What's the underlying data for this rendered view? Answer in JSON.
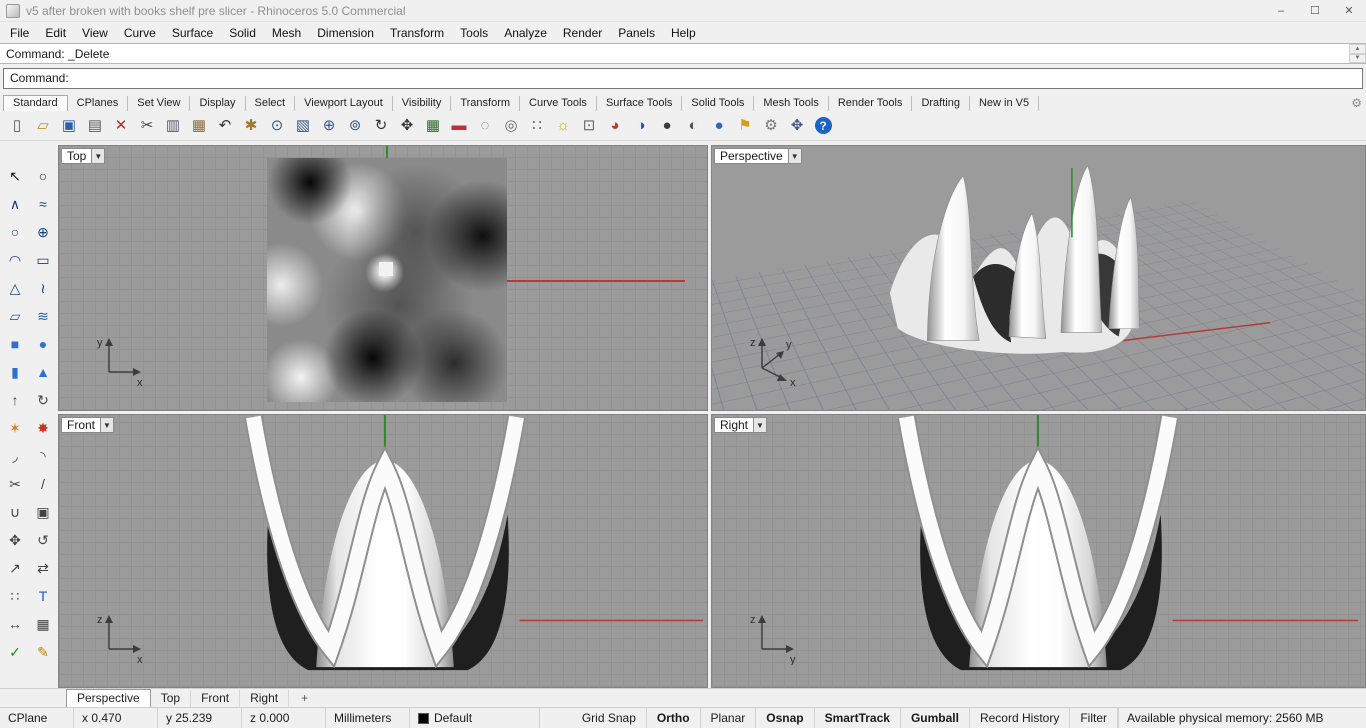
{
  "window": {
    "title": "v5 after broken with books shelf pre slicer - Rhinoceros 5.0 Commercial",
    "controls": {
      "minimize": "–",
      "maximize": "☐",
      "close": "✕"
    }
  },
  "menubar": {
    "items": [
      "File",
      "Edit",
      "View",
      "Curve",
      "Surface",
      "Solid",
      "Mesh",
      "Dimension",
      "Transform",
      "Tools",
      "Analyze",
      "Render",
      "Panels",
      "Help"
    ]
  },
  "command": {
    "history": "Command: _Delete",
    "prompt": "Command:",
    "scroll_up": "▲",
    "scroll_down": "▼"
  },
  "toolbar_tabs": {
    "active": "Standard",
    "gear": "⚙",
    "items": [
      "Standard",
      "CPlanes",
      "Set View",
      "Display",
      "Select",
      "Viewport Layout",
      "Visibility",
      "Transform",
      "Curve Tools",
      "Surface Tools",
      "Solid Tools",
      "Mesh Tools",
      "Render Tools",
      "Drafting",
      "New in V5"
    ]
  },
  "toolbar_icons": [
    {
      "name": "new-file-icon",
      "glyph": "▯",
      "color": "#555555"
    },
    {
      "name": "open-file-icon",
      "glyph": "▱",
      "color": "#b8912a"
    },
    {
      "name": "save-icon",
      "glyph": "▣",
      "color": "#2b5fae"
    },
    {
      "name": "print-icon",
      "glyph": "▤",
      "color": "#555555"
    },
    {
      "name": "delete-icon",
      "glyph": "✕",
      "color": "#b03030"
    },
    {
      "name": "cut-icon",
      "glyph": "✂",
      "color": "#444444"
    },
    {
      "name": "copy-icon",
      "glyph": "▥",
      "color": "#555566"
    },
    {
      "name": "paste-icon",
      "glyph": "▦",
      "color": "#8a6a3a"
    },
    {
      "name": "undo-icon",
      "glyph": "↶",
      "color": "#333333"
    },
    {
      "name": "pan-hand-icon",
      "glyph": "✱",
      "color": "#a07a2a"
    },
    {
      "name": "dynamic-zoom-icon",
      "glyph": "⊙",
      "color": "#33588a"
    },
    {
      "name": "zoom-window-icon",
      "glyph": "▧",
      "color": "#33588a"
    },
    {
      "name": "zoom-extents-icon",
      "glyph": "⊕",
      "color": "#33588a"
    },
    {
      "name": "zoom-selected-icon",
      "glyph": "⊚",
      "color": "#33588a"
    },
    {
      "name": "rotate-view-icon",
      "glyph": "↻",
      "color": "#333333"
    },
    {
      "name": "pan-view-icon",
      "glyph": "✥",
      "color": "#333333"
    },
    {
      "name": "four-viewports-icon",
      "glyph": "▦",
      "color": "#2a6a2a"
    },
    {
      "name": "named-views-icon",
      "glyph": "▬",
      "color": "#c03030"
    },
    {
      "name": "hide-object-icon",
      "glyph": "◌",
      "color": "#666666"
    },
    {
      "name": "show-object-icon",
      "glyph": "◎",
      "color": "#666666"
    },
    {
      "name": "object-snap-icon",
      "glyph": "∷",
      "color": "#666666"
    },
    {
      "name": "light-icon",
      "glyph": "☼",
      "color": "#c9a520"
    },
    {
      "name": "lock-icon",
      "glyph": "⊡",
      "color": "#666666"
    },
    {
      "name": "render-preview-icon",
      "glyph": "◕",
      "color": "#c23a2a"
    },
    {
      "name": "render-icon",
      "glyph": "◑",
      "color": "#2a52c2"
    },
    {
      "name": "shaded-display-icon",
      "glyph": "●",
      "color": "#3a3a3a"
    },
    {
      "name": "rendered-display-icon",
      "glyph": "◐",
      "color": "#555555"
    },
    {
      "name": "xray-display-icon",
      "glyph": "●",
      "color": "#2a6ac2"
    },
    {
      "name": "flag-icon",
      "glyph": "⚑",
      "color": "#d4a017"
    },
    {
      "name": "options-gear-icon",
      "glyph": "⚙",
      "color": "#777777"
    },
    {
      "name": "gumball-widget-icon",
      "glyph": "✥",
      "color": "#445588"
    },
    {
      "name": "help-icon",
      "glyph": "?",
      "color": "#ffffff",
      "bg": "#1a63c8"
    }
  ],
  "sidebar_tools": [
    {
      "name": "select-arrow-icon",
      "glyph": "↖",
      "color": "#1a1a1a"
    },
    {
      "name": "point-icon",
      "glyph": "○",
      "color": "#1a1a1a"
    },
    {
      "name": "polyline-icon",
      "glyph": "∧",
      "color": "#123f7a"
    },
    {
      "name": "curve-icon",
      "glyph": "≈",
      "color": "#123f7a"
    },
    {
      "name": "circle-icon",
      "glyph": "○",
      "color": "#123f7a"
    },
    {
      "name": "circle-deformable-icon",
      "glyph": "⊕",
      "color": "#123f7a"
    },
    {
      "name": "arc-icon",
      "glyph": "◠",
      "color": "#123f7a"
    },
    {
      "name": "rectangle-icon",
      "glyph": "▭",
      "color": "#123f7a"
    },
    {
      "name": "polygon-icon",
      "glyph": "△",
      "color": "#123f7a"
    },
    {
      "name": "freeform-curve-icon",
      "glyph": "≀",
      "color": "#123f7a"
    },
    {
      "name": "surface-from-curves-icon",
      "glyph": "▱",
      "color": "#1c5fae"
    },
    {
      "name": "loft-surface-icon",
      "glyph": "≋",
      "color": "#1c5fae"
    },
    {
      "name": "box-icon",
      "glyph": "■",
      "color": "#2f6fd0"
    },
    {
      "name": "sphere-icon",
      "glyph": "●",
      "color": "#2f6fd0"
    },
    {
      "name": "cylinder-icon",
      "glyph": "▮",
      "color": "#2f6fd0"
    },
    {
      "name": "cone-icon",
      "glyph": "▲",
      "color": "#2f6fd0"
    },
    {
      "name": "extrude-icon",
      "glyph": "↑",
      "color": "#444444"
    },
    {
      "name": "revolve-icon",
      "glyph": "↻",
      "color": "#444444"
    },
    {
      "name": "boolean-union-icon",
      "glyph": "✶",
      "color": "#e07b1a"
    },
    {
      "name": "explode-icon",
      "glyph": "✸",
      "color": "#d03020"
    },
    {
      "name": "fillet-icon",
      "glyph": "◞",
      "color": "#444444"
    },
    {
      "name": "blend-icon",
      "glyph": "◝",
      "color": "#444444"
    },
    {
      "name": "trim-icon",
      "glyph": "✂",
      "color": "#444444"
    },
    {
      "name": "split-icon",
      "glyph": "/",
      "color": "#444444"
    },
    {
      "name": "join-icon",
      "glyph": "∪",
      "color": "#444444"
    },
    {
      "name": "group-icon",
      "glyph": "▣",
      "color": "#444444"
    },
    {
      "name": "move-icon",
      "glyph": "✥",
      "color": "#444444"
    },
    {
      "name": "rotate-icon",
      "glyph": "↺",
      "color": "#444444"
    },
    {
      "name": "scale-icon",
      "glyph": "↗",
      "color": "#444444"
    },
    {
      "name": "mirror-icon",
      "glyph": "⇄",
      "color": "#444444"
    },
    {
      "name": "array-icon",
      "glyph": "∷",
      "color": "#444444"
    },
    {
      "name": "text-icon",
      "glyph": "T",
      "color": "#2255cc"
    },
    {
      "name": "dimension-icon",
      "glyph": "↔",
      "color": "#444444"
    },
    {
      "name": "hatch-icon",
      "glyph": "▦",
      "color": "#444444"
    },
    {
      "name": "check-errors-icon",
      "glyph": "✓",
      "color": "#1f8b1f"
    },
    {
      "name": "sketch-icon",
      "glyph": "✎",
      "color": "#b8860b"
    }
  ],
  "viewports": {
    "label_arrow": "▼",
    "top": {
      "label": "Top",
      "axis": {
        "v": "y",
        "h": "x"
      }
    },
    "perspective": {
      "label": "Perspective",
      "axis": {
        "v": "z",
        "h": "x",
        "d": "y"
      }
    },
    "front": {
      "label": "Front",
      "axis": {
        "v": "z",
        "h": "x"
      }
    },
    "right": {
      "label": "Right",
      "axis": {
        "v": "z",
        "h": "y"
      }
    }
  },
  "viewport_tabs": {
    "active": "Perspective",
    "add": "+",
    "items": [
      "Perspective",
      "Top",
      "Front",
      "Right"
    ]
  },
  "statusbar": {
    "cplane_label": "CPlane",
    "coords": {
      "x": "x 0.470",
      "y": "y 25.239",
      "z": "z 0.000"
    },
    "units": "Millimeters",
    "layer": {
      "name": "Default",
      "swatch": "#000000"
    },
    "toggles": [
      {
        "label": "Grid Snap",
        "active": false
      },
      {
        "label": "Ortho",
        "active": true
      },
      {
        "label": "Planar",
        "active": false
      },
      {
        "label": "Osnap",
        "active": true
      },
      {
        "label": "SmartTrack",
        "active": true
      },
      {
        "label": "Gumball",
        "active": true
      },
      {
        "label": "Record History",
        "active": false
      },
      {
        "label": "Filter",
        "active": false
      }
    ],
    "memory": "Available physical memory: 2560 MB"
  },
  "colors": {
    "axis_x_red": "#b23b3b",
    "axis_y_green": "#2e8b2e",
    "viewport_background": "#9b9b9b",
    "accent_blue": "#1a63c8"
  }
}
